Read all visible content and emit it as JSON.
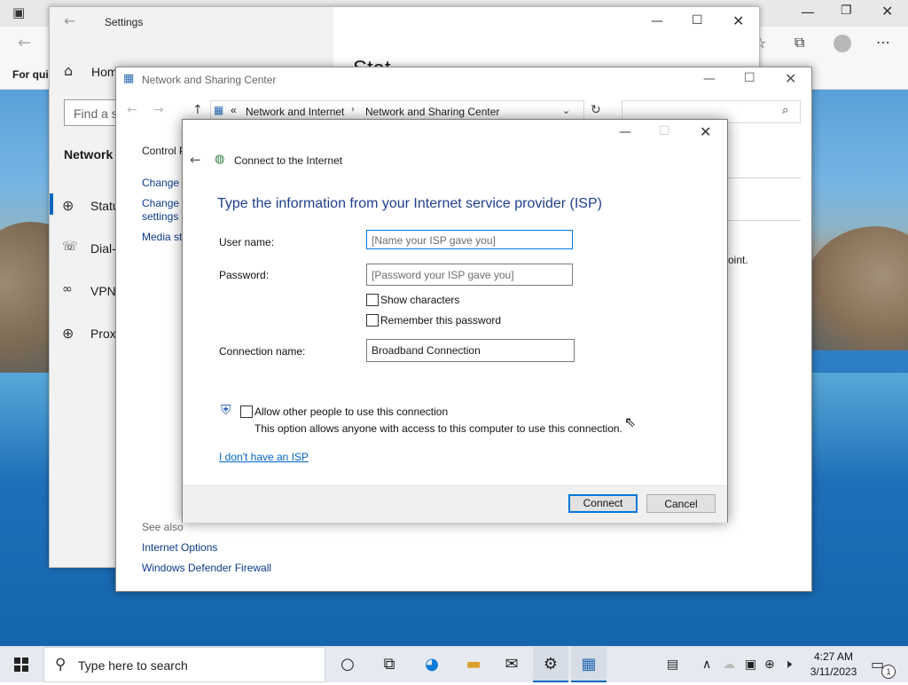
{
  "edge": {
    "fav_text": "For quic"
  },
  "settings": {
    "title": "Settings",
    "home_label": "Hom",
    "search_placeholder": "Find a s",
    "section_title": "Network",
    "nav": [
      {
        "label": "Statu",
        "icon": "globe-network-icon"
      },
      {
        "label": "Dial-",
        "icon": "dial-up-icon"
      },
      {
        "label": "VPN",
        "icon": "vpn-icon"
      },
      {
        "label": "Prox",
        "icon": "proxy-globe-icon"
      }
    ],
    "right_heading_partial": "Stat"
  },
  "nsc": {
    "title": "Network and Sharing Center",
    "breadcrumb_chevrons": "«",
    "breadcrumb": [
      "Network and Internet",
      "Network and Sharing Center"
    ],
    "left_links": [
      "Control P",
      "Change a",
      "Change a",
      "settings",
      "Media st"
    ],
    "see_also_title": "See also",
    "see_also_links": [
      "Internet Options",
      "Windows Defender Firewall"
    ],
    "right_text_partial": "oint."
  },
  "dialog": {
    "title": "Connect to the Internet",
    "heading": "Type the information from your Internet service provider (ISP)",
    "username_label": "User name:",
    "username_placeholder": "[Name your ISP gave you]",
    "password_label": "Password:",
    "password_placeholder": "[Password your ISP gave you]",
    "show_characters": "Show characters",
    "remember_password": "Remember this password",
    "connection_name_label": "Connection name:",
    "connection_name_value": "Broadband Connection",
    "allow_others": "Allow other people to use this connection",
    "allow_others_desc": "This option allows anyone with access to this computer to use this connection.",
    "no_isp_link": "I don't have an ISP",
    "connect_button": "Connect",
    "cancel_button": "Cancel"
  },
  "taskbar": {
    "search_placeholder": "Type here to search",
    "time": "4:27 AM",
    "date": "3/11/2023",
    "notification_count": "1"
  },
  "colors": {
    "accent": "#0078d7",
    "heading_blue": "#1e3f8c",
    "link_blue": "#0066cc"
  }
}
